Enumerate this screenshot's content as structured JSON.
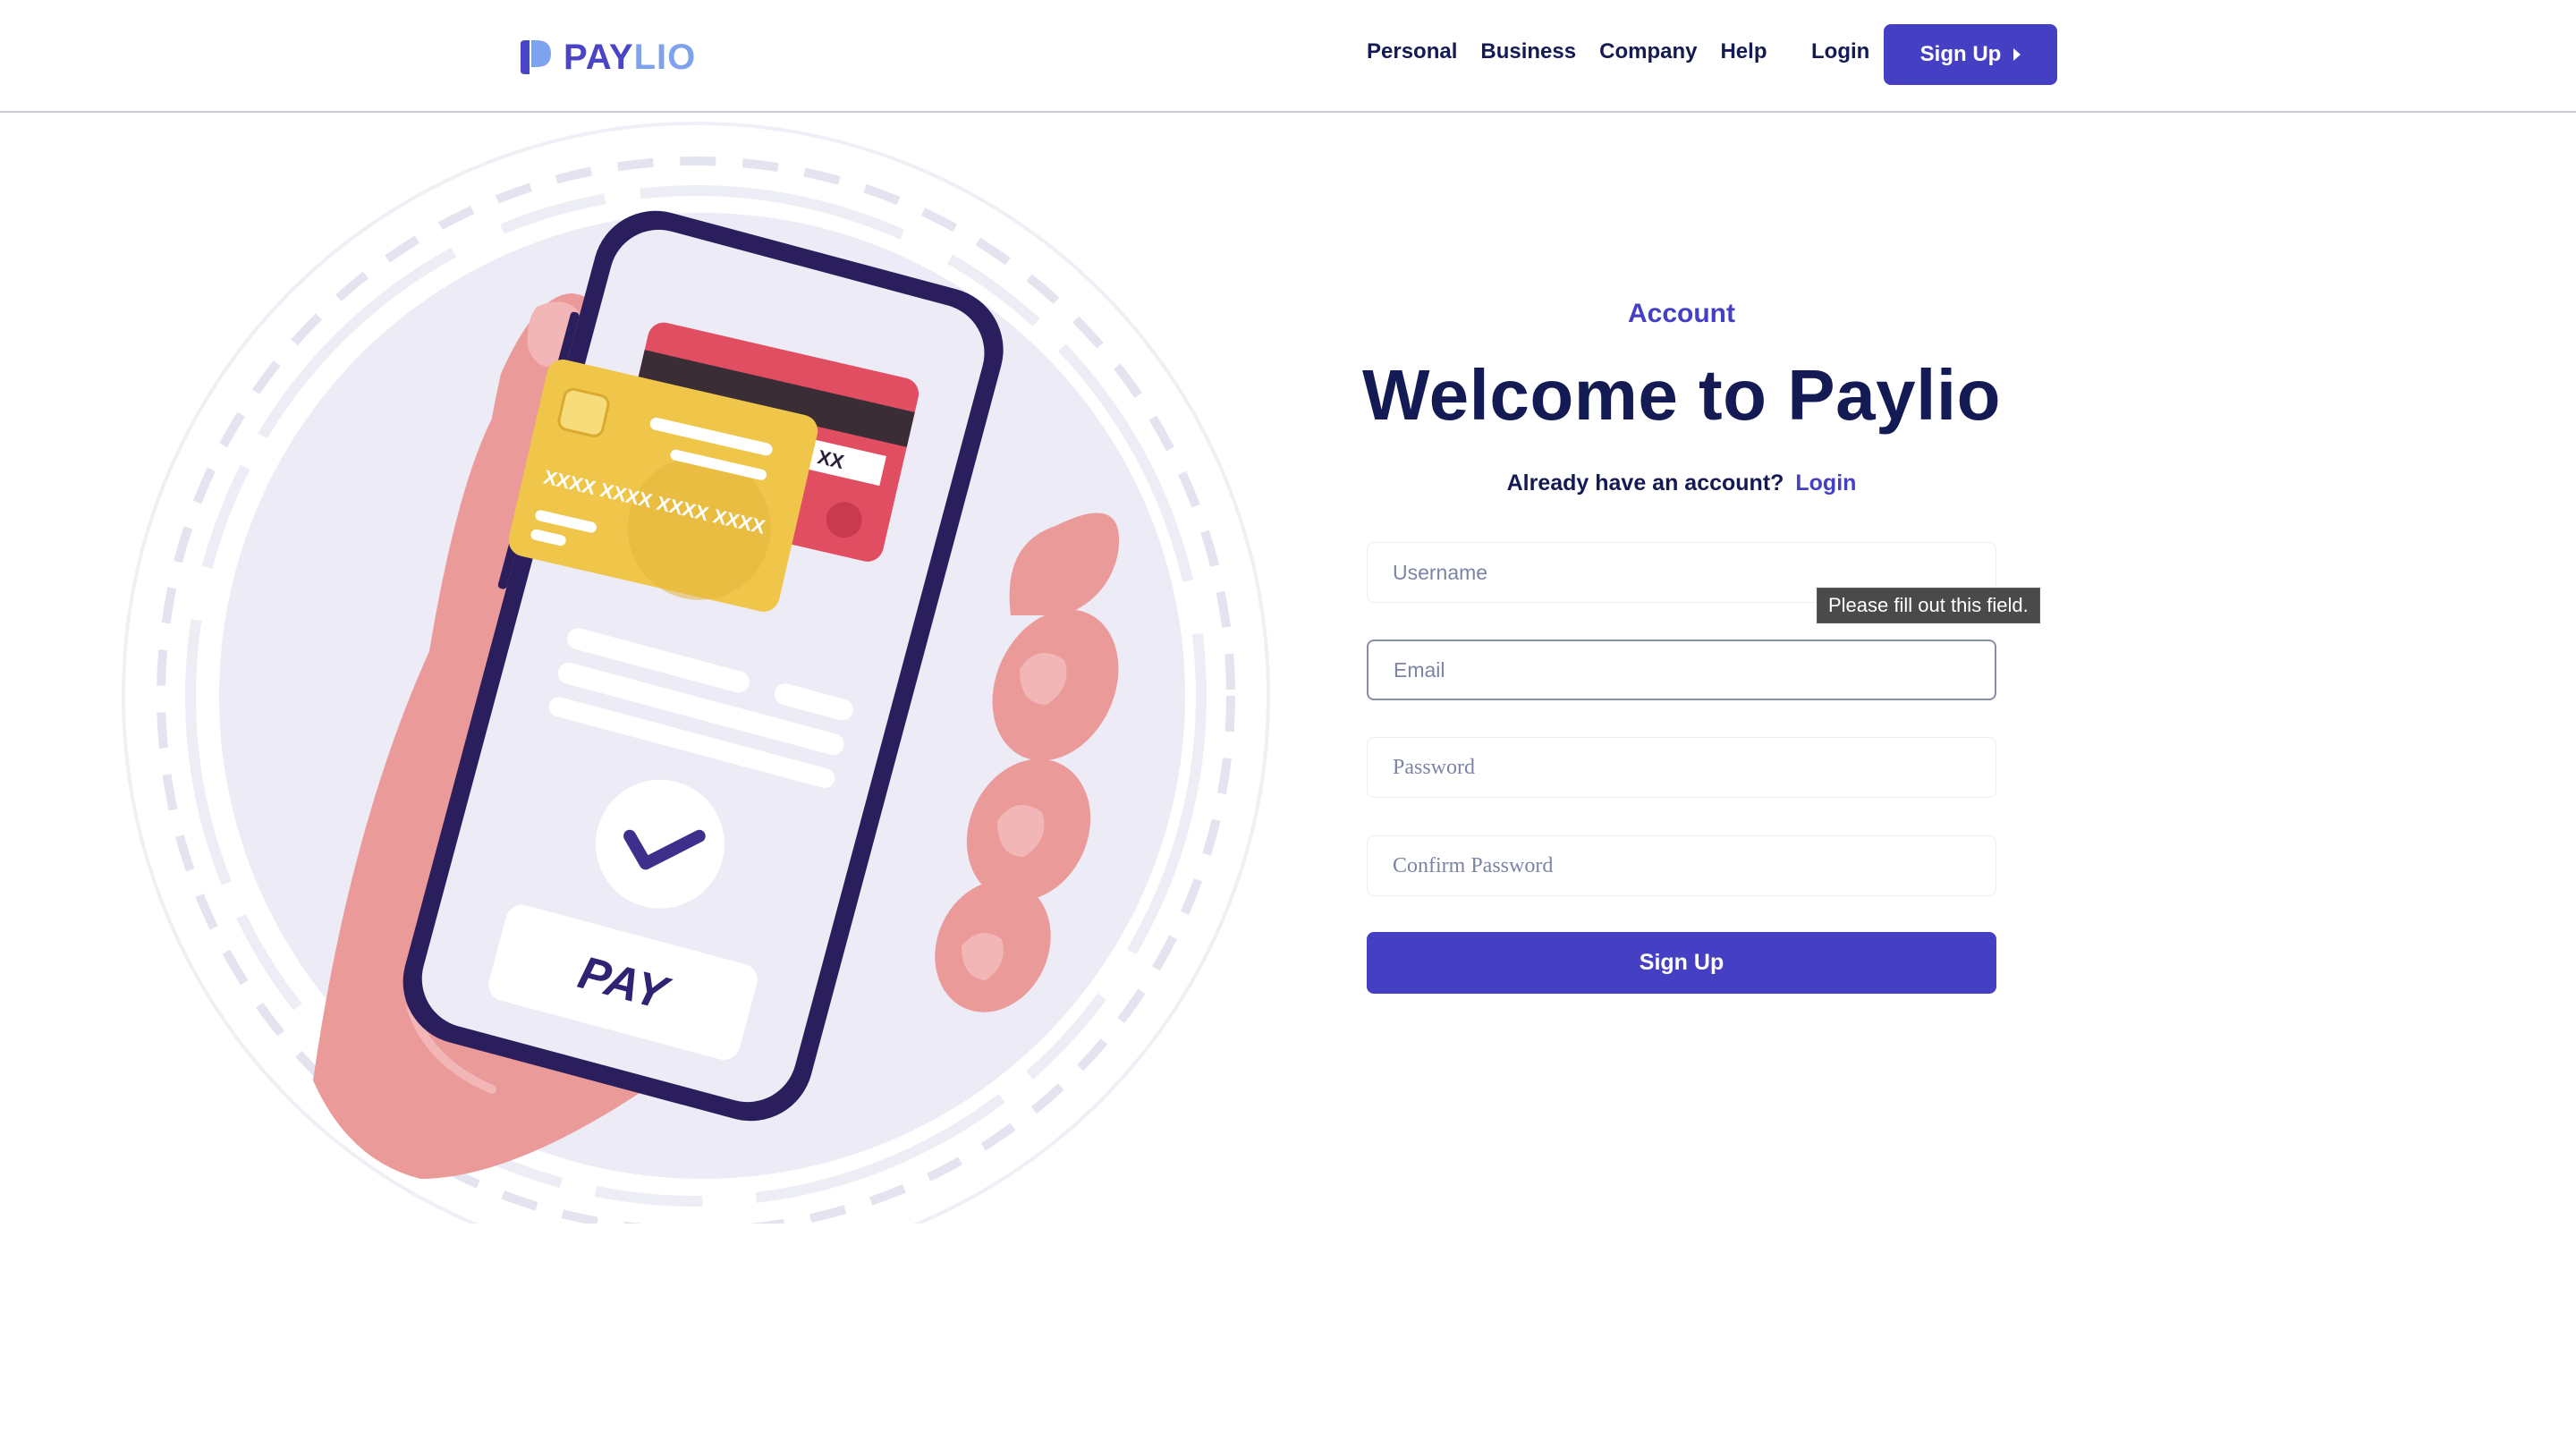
{
  "brand": {
    "name_part1": "PAY",
    "name_part2": "LIO",
    "primary_color": "#4540c3",
    "navy_color": "#131a54",
    "accent_light": "#7fa2ee"
  },
  "nav": {
    "items": [
      "Personal",
      "Business",
      "Company",
      "Help"
    ],
    "login_label": "Login",
    "signup_label": "Sign Up",
    "signup_icon": "caret-right-icon"
  },
  "illustration": {
    "card_number": "XXXX XXXX XXXX XXXX",
    "card_back_text": "XX",
    "pay_label": "PAY",
    "check_icon": "checkmark-icon"
  },
  "form": {
    "eyebrow": "Account",
    "title": "Welcome to Paylio",
    "subline_text": "Already have an account?",
    "subline_link": "Login",
    "username_placeholder": "Username",
    "email_placeholder": "Email",
    "password_placeholder": "Password",
    "confirm_placeholder": "Confirm Password",
    "submit_label": "Sign Up",
    "validation_tooltip": "Please fill out this field."
  }
}
